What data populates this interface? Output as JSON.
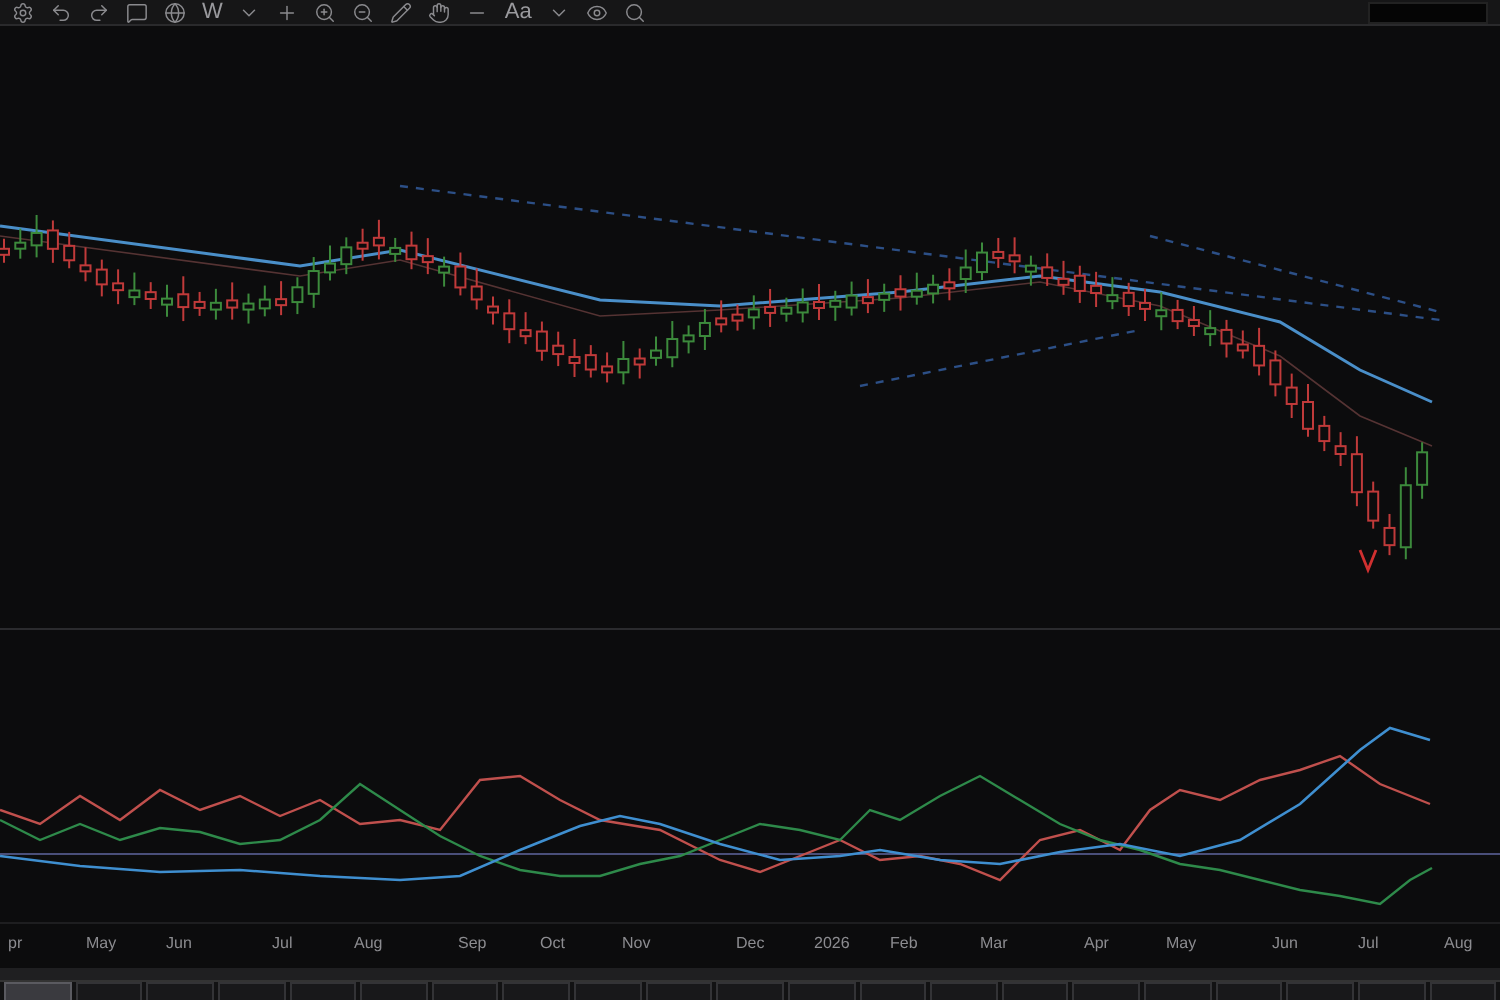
{
  "toolbar": {
    "interval": "W",
    "text_tool": "Aa"
  },
  "time_axis": {
    "labels": [
      "pr",
      "May",
      "Jun",
      "Jul",
      "Aug",
      "Sep",
      "Oct",
      "Nov",
      "Dec",
      "2026",
      "Feb",
      "Mar",
      "Apr",
      "May",
      "Jun",
      "Jul",
      "Aug"
    ]
  },
  "symbol_tabs": [
    {
      "selected": true
    },
    {
      "selected": false
    },
    {
      "selected": false
    },
    {
      "selected": false
    },
    {
      "selected": false
    },
    {
      "selected": false
    },
    {
      "selected": false
    },
    {
      "selected": false
    },
    {
      "selected": false
    },
    {
      "selected": false
    },
    {
      "selected": false
    },
    {
      "selected": false
    },
    {
      "selected": false
    },
    {
      "selected": false
    },
    {
      "selected": false
    },
    {
      "selected": false
    },
    {
      "selected": false
    },
    {
      "selected": false
    },
    {
      "selected": false
    },
    {
      "selected": false
    },
    {
      "selected": false
    }
  ]
}
